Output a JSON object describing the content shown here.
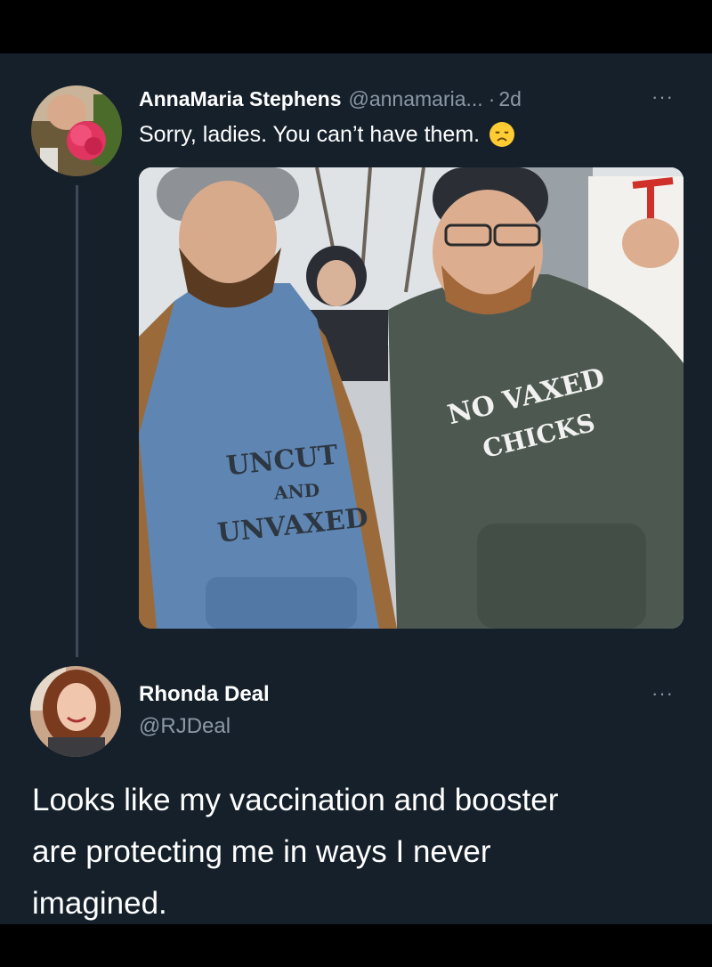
{
  "tweet": {
    "author_name": "AnnaMaria Stephens",
    "author_handle": "@annamaria...",
    "separator": "·",
    "age": "2d",
    "more": "···",
    "text": "Sorry, ladies. You can’t have them.",
    "emoji": "disappointed-face-emoji",
    "avatar_icon": "rose-avatar",
    "photo": {
      "left_shirt": [
        "UNCUT",
        "AND",
        "UNVAXED"
      ],
      "right_shirt": [
        "NO VAXED",
        "CHICKS"
      ]
    }
  },
  "reply": {
    "author_name": "Rhonda Deal",
    "author_handle": "@RJDeal",
    "more": "···",
    "text_lines": [
      "Looks like my vaccination and booster",
      "are protecting me in ways I never",
      "imagined."
    ]
  },
  "colors": {
    "background": "#15202b",
    "text": "#ffffff",
    "muted": "#8b98a5"
  }
}
